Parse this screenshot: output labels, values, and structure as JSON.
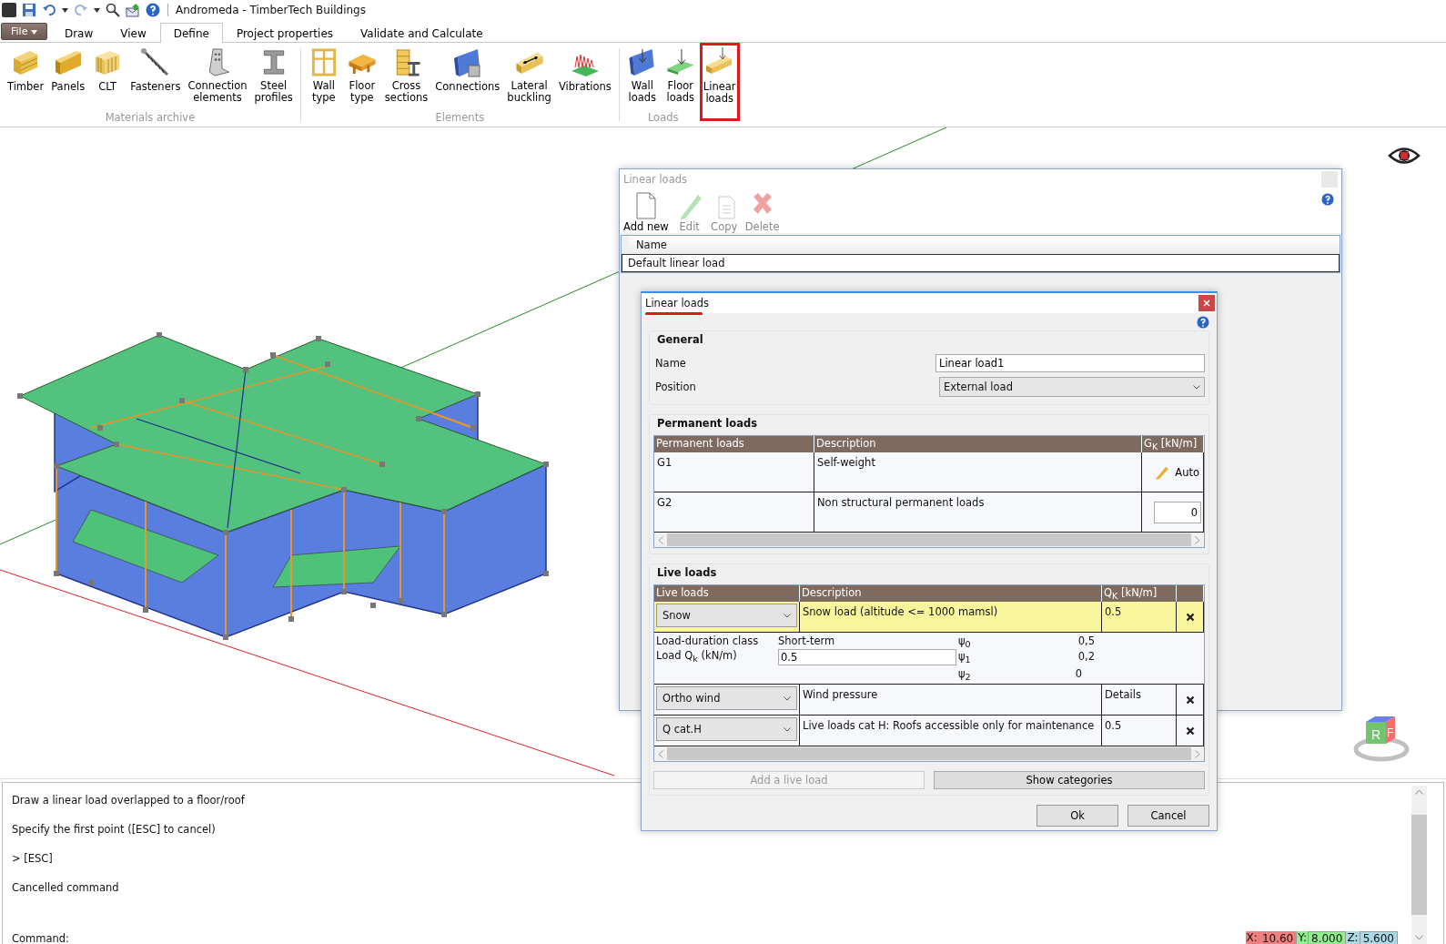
{
  "window": {
    "title": "Andromeda - TimberTech Buildings"
  },
  "menu_tabs": [
    {
      "label": "File",
      "kind": "file",
      "selected": false
    },
    {
      "label": "Draw",
      "kind": "tab",
      "selected": false
    },
    {
      "label": "View",
      "kind": "tab",
      "selected": false
    },
    {
      "label": "Define",
      "kind": "tab",
      "selected": true
    },
    {
      "label": "Project properties",
      "kind": "tab",
      "selected": false
    },
    {
      "label": "Validate and Calculate",
      "kind": "tab",
      "selected": false
    }
  ],
  "ribbon_groups": [
    {
      "label": "Materials archive",
      "buttons": [
        {
          "lines": [
            "Timber"
          ],
          "kind": "beam",
          "highlighted": false
        },
        {
          "lines": [
            "Panels"
          ],
          "kind": "panel",
          "highlighted": false
        },
        {
          "lines": [
            "CLT"
          ],
          "kind": "clt",
          "highlighted": false
        },
        {
          "lines": [
            "Fasteners"
          ],
          "kind": "screw",
          "highlighted": false
        },
        {
          "lines": [
            "Connection",
            "elements"
          ],
          "kind": "bracket",
          "highlighted": false
        },
        {
          "lines": [
            "Steel",
            "profiles"
          ],
          "kind": "ibeam",
          "highlighted": false
        }
      ]
    },
    {
      "label": "Elements",
      "buttons": [
        {
          "lines": [
            "Wall",
            "type"
          ],
          "kind": "frame",
          "highlighted": false
        },
        {
          "lines": [
            "Floor",
            "type"
          ],
          "kind": "floor",
          "highlighted": false
        },
        {
          "lines": [
            "Cross",
            "sections"
          ],
          "kind": "section",
          "highlighted": false
        },
        {
          "lines": [
            "Connections"
          ],
          "kind": "connection",
          "highlighted": false
        },
        {
          "lines": [
            "Lateral",
            "buckling"
          ],
          "kind": "lateral",
          "highlighted": false
        },
        {
          "lines": [
            "Vibrations"
          ],
          "kind": "vibration",
          "highlighted": false
        }
      ]
    },
    {
      "label": "Loads",
      "buttons": [
        {
          "lines": [
            "Wall",
            "loads"
          ],
          "kind": "wallload",
          "highlighted": false
        },
        {
          "lines": [
            "Floor",
            "loads"
          ],
          "kind": "floorload",
          "highlighted": false
        },
        {
          "lines": [
            "Linear",
            "loads"
          ],
          "kind": "linearload",
          "highlighted": true
        }
      ]
    }
  ],
  "view_cube": {
    "faces": [
      "R",
      "F"
    ]
  },
  "list_dialog": {
    "title": "Linear loads",
    "toolbar": [
      {
        "label": "Add new",
        "kind": "new",
        "disabled": false
      },
      {
        "label": "Edit",
        "kind": "edit",
        "disabled": true
      },
      {
        "label": "Copy",
        "kind": "copy",
        "disabled": true
      },
      {
        "label": "Delete",
        "kind": "delete",
        "disabled": true
      }
    ],
    "column": "Name",
    "rows": [
      "Default linear load"
    ]
  },
  "edit_dialog": {
    "title": "Linear loads",
    "general": {
      "title": "General",
      "name_label": "Name",
      "name_value": "Linear load1",
      "position_label": "Position",
      "position_value": "External load"
    },
    "permanent": {
      "title": "Permanent loads",
      "columns": [
        "Permanent loads",
        "Description",
        "G$_{K}$ [kN/m]"
      ],
      "rows": [
        {
          "name": "G1",
          "description": "Self-weight",
          "kind": "auto",
          "value": "Auto"
        },
        {
          "name": "G2",
          "description": "Non structural permanent loads",
          "kind": "input",
          "value": "0"
        }
      ]
    },
    "live": {
      "title": "Live loads",
      "columns": [
        "Live loads",
        "Description",
        "Q$_{K}$ [kN/m]"
      ],
      "rows": [
        {
          "type": "Snow",
          "description": "Snow load (altitude <= 1000 mamsl)",
          "value": "0.5",
          "highlighted": true,
          "expanded": true,
          "details": {
            "duration_label": "Load-duration class",
            "duration_value": "Short-term",
            "load_label": "Load Q$_{k}$ (kN/m)",
            "load_value": "0.5",
            "psi": [
              {
                "label": "ψ$_{0}$",
                "value": "0,5"
              },
              {
                "label": "ψ$_{1}$",
                "value": "0,2"
              },
              {
                "label": "ψ$_{2}$",
                "value": "0"
              }
            ]
          }
        },
        {
          "type": "Ortho wind",
          "description": "Wind pressure",
          "value": "Details",
          "highlighted": false,
          "expanded": false
        },
        {
          "type": "Q cat.H",
          "description": "Live loads cat H: Roofs accessible only for maintenance",
          "value": "0.5",
          "highlighted": false,
          "expanded": false
        }
      ],
      "add_button": {
        "label": "Add a live load",
        "disabled": true
      },
      "categories_button": {
        "label": "Show categories",
        "disabled": false
      }
    },
    "buttons": [
      "Ok",
      "Cancel"
    ]
  },
  "command": {
    "lines": [
      "Draw a linear load overlapped to a floor/roof",
      "Specify the first point ([ESC] to cancel)",
      "> [ESC]",
      "Cancelled command"
    ],
    "prompt": "Command:"
  },
  "coordinates": [
    {
      "label": "X:",
      "value": "10.60",
      "color": "#f08080"
    },
    {
      "label": "Y:",
      "value": "8.000",
      "color": "#90ee90"
    },
    {
      "label": "Z:",
      "value": "5.600",
      "color": "#add8e6"
    }
  ]
}
